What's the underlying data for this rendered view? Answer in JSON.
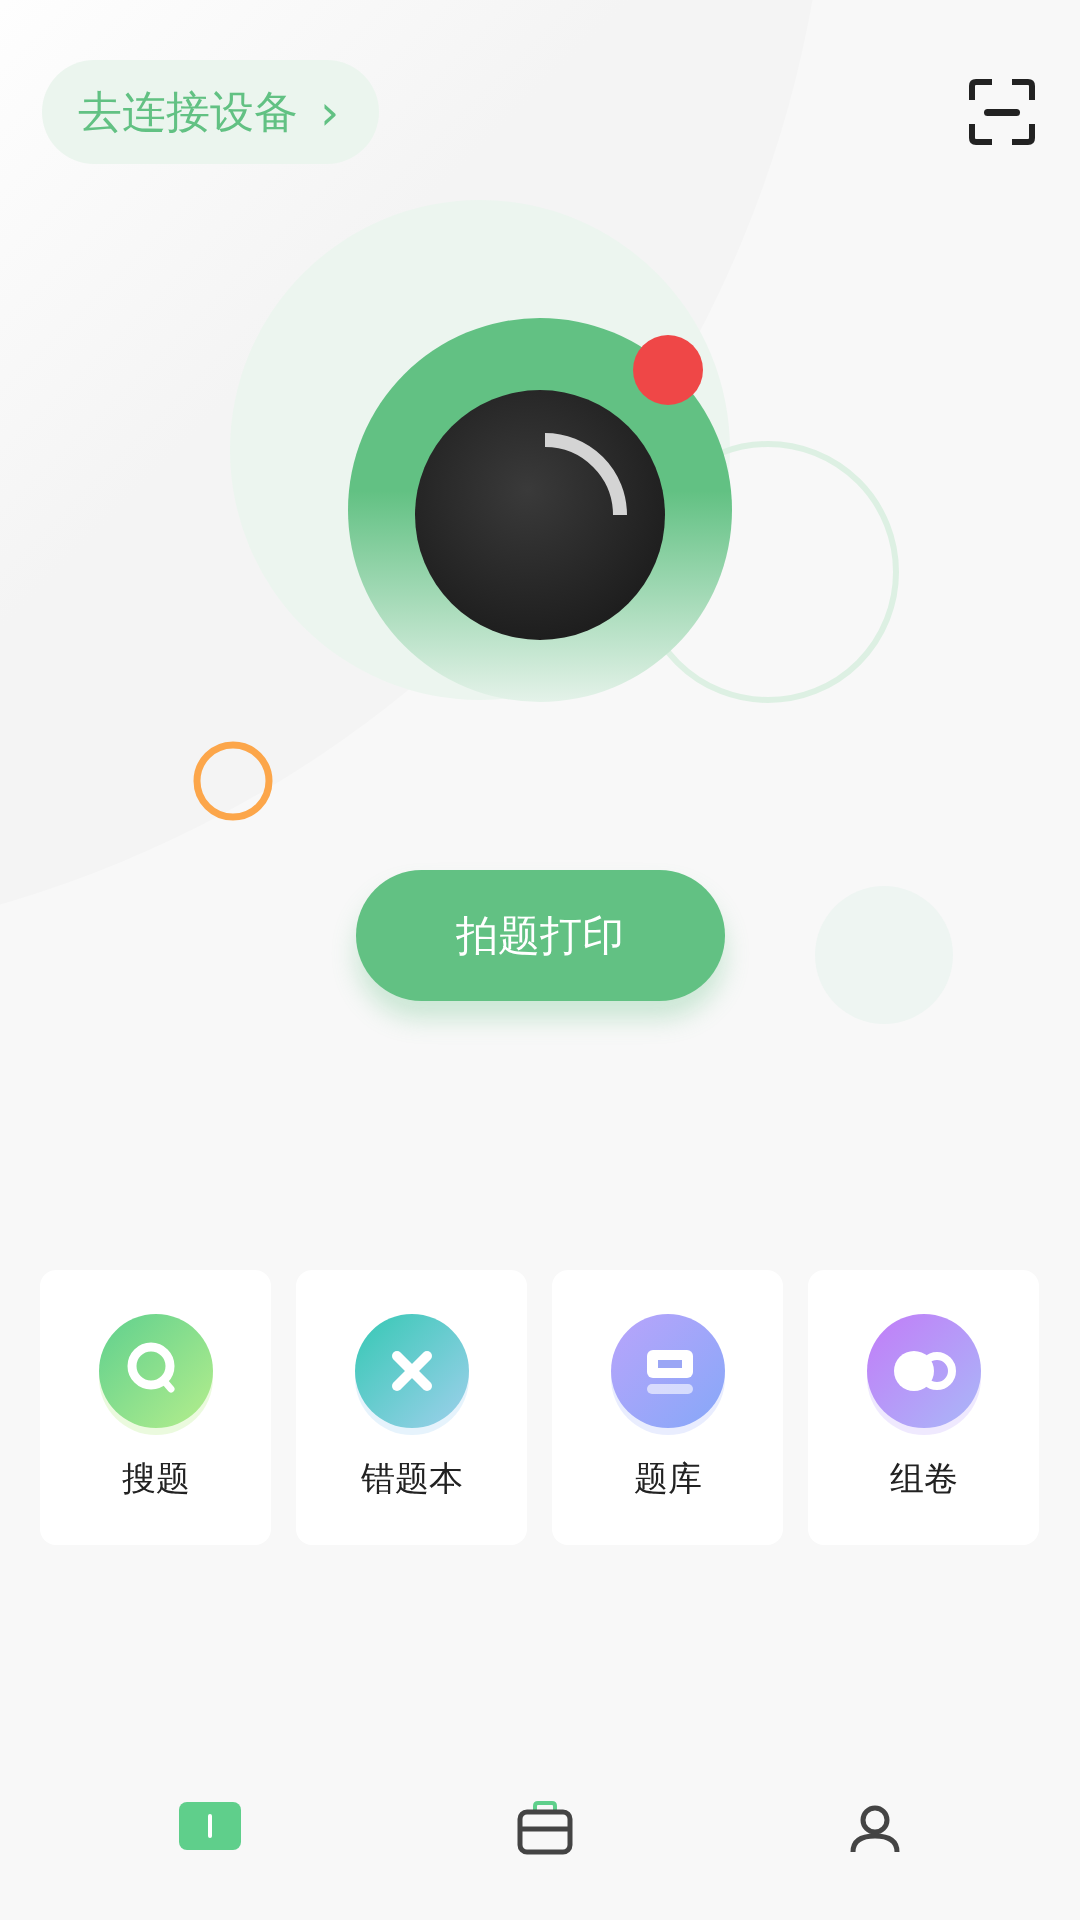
{
  "header": {
    "connect_button": {
      "label": "去连接设备",
      "chevron": "›"
    }
  },
  "print_button": {
    "label": "拍题打印"
  },
  "features": [
    {
      "label": "搜题",
      "kind": "search"
    },
    {
      "label": "错题本",
      "kind": "mistakes"
    },
    {
      "label": "题库",
      "kind": "bank"
    },
    {
      "label": "组卷",
      "kind": "compose"
    }
  ],
  "bottom_nav": [
    {
      "kind": "home",
      "selected": true
    },
    {
      "kind": "tools",
      "selected": false
    },
    {
      "kind": "profile",
      "selected": false
    }
  ]
}
